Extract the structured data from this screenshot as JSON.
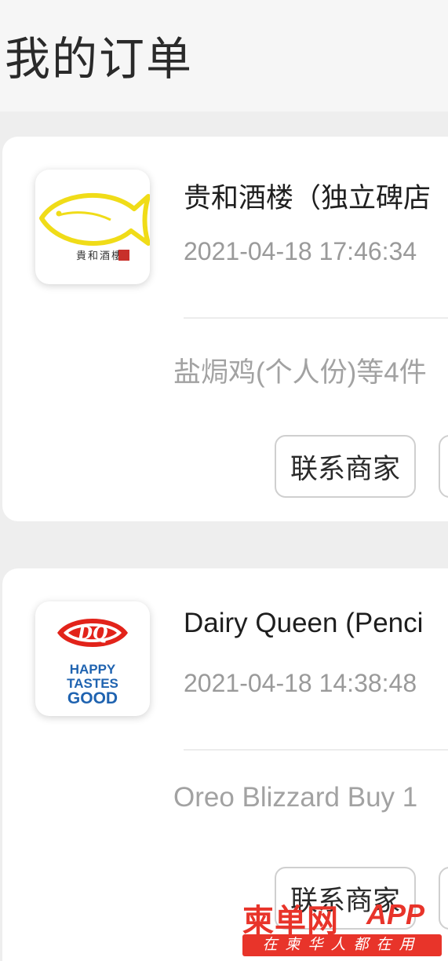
{
  "header": {
    "title": "我的订单"
  },
  "orders": [
    {
      "store_name": "贵和酒楼（独立碑店",
      "logo_text": "貴和酒樓",
      "logo_seal": "印",
      "time": "2021-04-18 17:46:34",
      "items": "盐焗鸡(个人份)等4件",
      "contact_label": "联系商家"
    },
    {
      "store_name": "Dairy Queen (Penci",
      "logo_brand": "DQ",
      "logo_tagline": [
        "HAPPY",
        "TASTES",
        "GOOD"
      ],
      "time": "2021-04-18 14:38:48",
      "items": "Oreo Blizzard Buy 1",
      "contact_label": "联系商家"
    }
  ],
  "watermark": {
    "brand": "柬单网",
    "app": "APP",
    "slogan": "在柬华人都在用"
  },
  "colors": {
    "accent": "#e8342a",
    "dq_red": "#e2231a",
    "dq_blue": "#1f63b0",
    "fish_yellow": "#f0dc18"
  }
}
